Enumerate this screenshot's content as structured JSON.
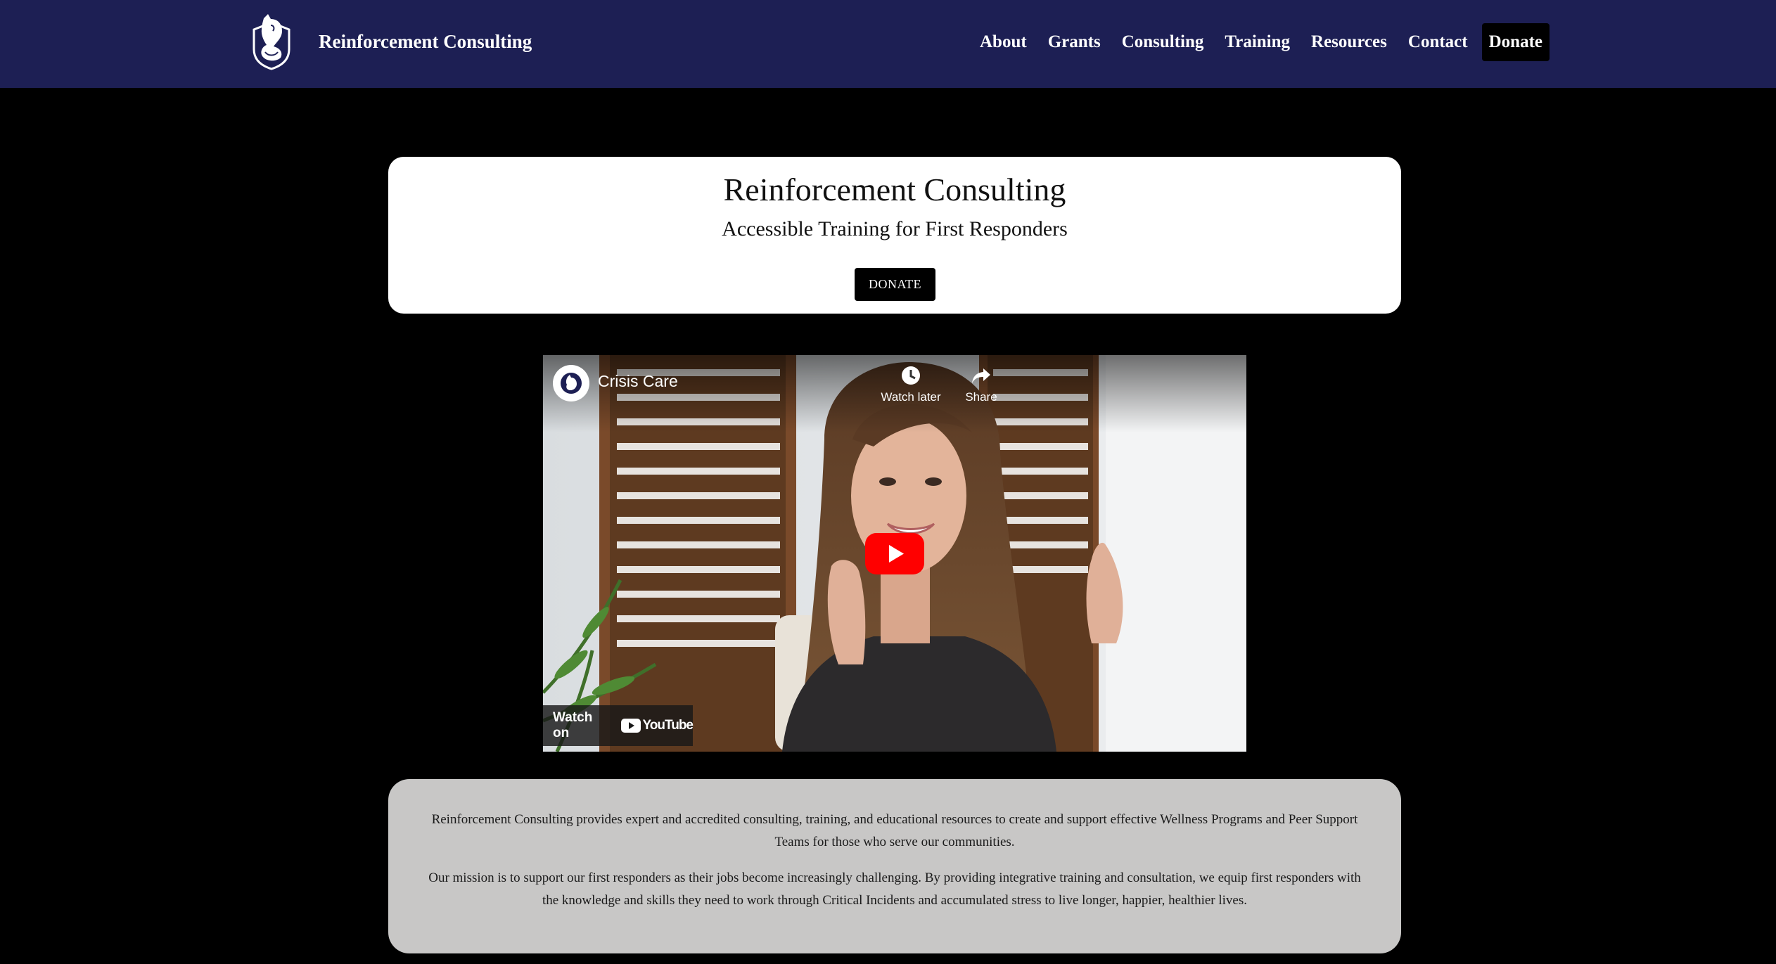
{
  "header": {
    "brand_name": "Reinforcement Consulting",
    "logo_icon": "shield-fox-logo-icon",
    "nav_items": [
      "About",
      "Grants",
      "Consulting",
      "Training",
      "Resources",
      "Contact"
    ],
    "donate_label": "Donate",
    "background_color": "#1d1f54"
  },
  "hero": {
    "title": "Reinforcement Consulting",
    "subtitle": "Accessible Training for First Responders",
    "donate_label": "DONATE"
  },
  "video": {
    "channel_title": "Crisis Care",
    "watch_later_label": "Watch later",
    "share_label": "Share",
    "watch_on_label": "Watch on",
    "platform_label": "YouTube",
    "play_icon": "play-icon",
    "play_color": "#ff0000"
  },
  "mission": {
    "paragraph_1": "Reinforcement Consulting provides expert and accredited consulting, training, and educational resources to create and support effective Wellness Programs and Peer Support Teams for those who serve our communities.",
    "paragraph_2": "Our mission is to support our first responders as their jobs become increasingly challenging. By providing integrative training and consultation, we equip first responders with the knowledge and skills they need to work through Critical Incidents and accumulated stress to live longer, happier, healthier lives."
  },
  "colors": {
    "page_background": "#000000",
    "card_white": "#ffffff",
    "card_grey": "#c8c7c6",
    "button_black": "#000000"
  }
}
